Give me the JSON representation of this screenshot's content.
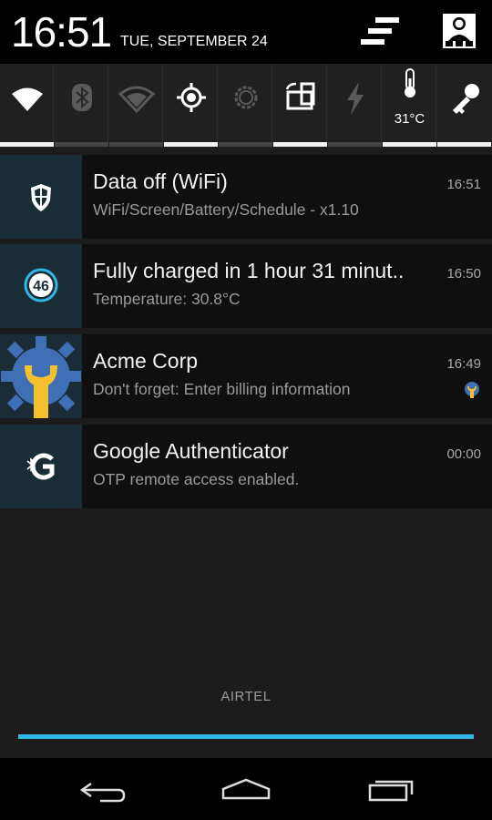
{
  "status": {
    "clock": "16:51",
    "date": "TUE, SEPTEMBER 24"
  },
  "header": {
    "settings_icon": "quick-settings-toggle-icon",
    "profile_icon": "user-profile-icon"
  },
  "quick_settings": {
    "tiles": [
      {
        "name": "wifi",
        "icon": "wifi-icon",
        "active": true
      },
      {
        "name": "bluetooth",
        "icon": "bluetooth-icon",
        "active": false
      },
      {
        "name": "mobile-data",
        "icon": "mobile-data-icon",
        "active": false
      },
      {
        "name": "gps",
        "icon": "gps-icon",
        "active": true
      },
      {
        "name": "brightness",
        "icon": "brightness-icon",
        "active": false
      },
      {
        "name": "auto-rotate",
        "icon": "rotate-icon",
        "active": true
      },
      {
        "name": "flash",
        "icon": "flash-icon",
        "active": false
      },
      {
        "name": "temperature",
        "icon": "thermometer-icon",
        "active": true,
        "label": "31°C"
      },
      {
        "name": "lock",
        "icon": "key-icon",
        "active": true
      }
    ]
  },
  "notifications": [
    {
      "title": "Data off (WiFi)",
      "text": "WiFi/Screen/Battery/Schedule - x1.10",
      "time": "16:51",
      "icon": "shield-icon"
    },
    {
      "title": "Fully charged in 1 hour 31 minut..",
      "text": "Temperature: 30.8°C",
      "time": "16:50",
      "icon": "battery-level-icon",
      "badge": "46"
    },
    {
      "title": "Acme Corp",
      "text": "Don't forget: Enter billing information",
      "time": "16:49",
      "icon": "gear-wrench-icon"
    },
    {
      "title": "Google Authenticator",
      "text": "OTP remote access enabled.",
      "time": "00:00",
      "icon": "authenticator-icon"
    }
  ],
  "footer": {
    "carrier": "AIRTEL"
  },
  "colors": {
    "accent": "#33b5e5",
    "icon_bg": "#1a2c36",
    "acme_blue": "#3f6fb5",
    "acme_yellow": "#f4c02e"
  },
  "nav": {
    "back_icon": "back-icon",
    "home_icon": "home-icon",
    "recents_icon": "recents-icon"
  }
}
